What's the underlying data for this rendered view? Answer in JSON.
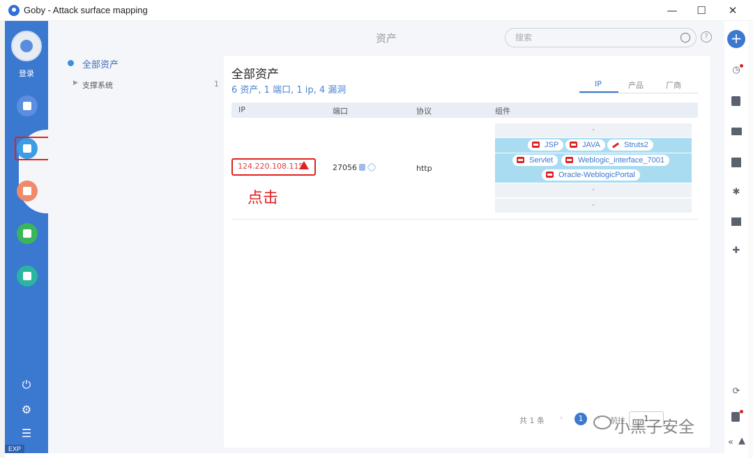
{
  "window": {
    "title": "Goby - Attack surface mapping",
    "controls": {
      "minimize": "—",
      "maximize": "☐",
      "close": "✕"
    }
  },
  "sidebar": {
    "login_label": "登录",
    "exp_label": "EXP",
    "items": [
      {
        "name": "scan-icon",
        "color": "#5b8de0"
      },
      {
        "name": "asset-icon",
        "color": "#3b9de6"
      },
      {
        "name": "vuln-icon",
        "color": "#f08a6a"
      },
      {
        "name": "chart-icon",
        "color": "#3ab55a"
      },
      {
        "name": "plugin-icon",
        "color": "#2ab5a0"
      }
    ],
    "footer": {
      "power": "⏻",
      "settings": "⚙",
      "menu": "☰"
    }
  },
  "header": {
    "title": "资产",
    "search_placeholder": "搜索",
    "help": "?"
  },
  "tree": {
    "root_label": "全部资产",
    "child_label": "支撑系统",
    "child_count": "1"
  },
  "panel": {
    "title": "全部资产",
    "summary": "6 资产, 1 端口, 1 ip, 4 漏洞",
    "tabs": [
      "IP",
      "产品",
      "厂商"
    ],
    "columns": [
      "IP",
      "端口",
      "协议",
      "组件"
    ],
    "row": {
      "ip": "124.220.108.115",
      "port": "27056",
      "protocol": "http",
      "blank": "-"
    },
    "components": {
      "row2": [
        "JSP",
        "JAVA",
        "Struts2"
      ],
      "row3": [
        "Servlet",
        "Weblogic_interface_7001"
      ],
      "row4": [
        "Oracle-WeblogicPortal"
      ]
    },
    "annotation": "点击"
  },
  "pager": {
    "total": "共 1 条",
    "prev": "‹",
    "current": "1",
    "next": "›",
    "goto_label": "前往",
    "goto_value": "1"
  },
  "rightbar": {
    "add": "+",
    "collapse": "«"
  },
  "watermark": "小黑子安全"
}
